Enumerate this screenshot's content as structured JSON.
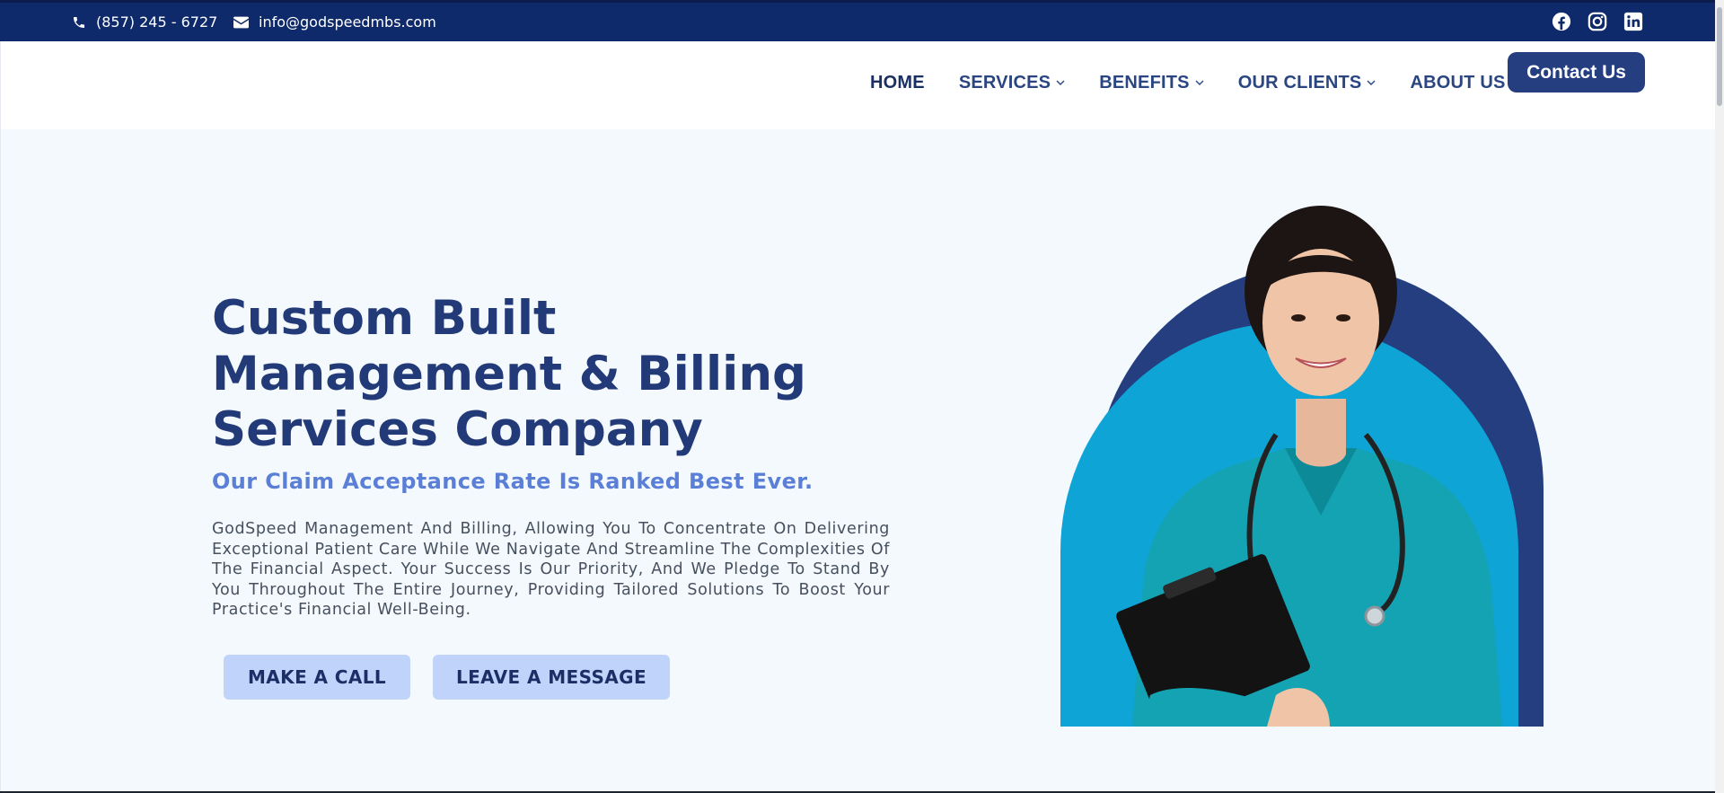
{
  "topbar": {
    "phone": "(857) 245 - 6727",
    "email": "info@godspeedmbs.com",
    "socials": [
      "facebook-icon",
      "instagram-icon",
      "linkedin-icon"
    ],
    "background": "#0f2a6b"
  },
  "nav": {
    "items": [
      {
        "label": "HOME",
        "dropdown": false
      },
      {
        "label": "SERVICES",
        "dropdown": true
      },
      {
        "label": "BENEFITS",
        "dropdown": true
      },
      {
        "label": "OUR CLIENTS",
        "dropdown": true
      },
      {
        "label": "ABOUT US",
        "dropdown": false
      }
    ],
    "contact_label": "Contact Us"
  },
  "hero": {
    "headline_lines": [
      "Custom Built",
      "Management & Billing",
      "Services Company"
    ],
    "subhead": "Our Claim Acceptance Rate Is Ranked Best Ever.",
    "paragraph": "GodSpeed Management And Billing, Allowing You To Concentrate On Delivering Exceptional Patient Care While We Navigate And Streamline The Complexities Of The Financial Aspect. Your Success Is Our Priority, And We Pledge To Stand By You Throughout The Entire Journey, Providing Tailored Solutions To Boost Your Practice's Financial Well-Being.",
    "call_label": "MAKE A CALL",
    "message_label": "LEAVE A MESSAGE"
  },
  "colors": {
    "brand_dark": "#243e7f",
    "accent_blue": "#5b7fd6",
    "button_light": "#c0d3fb",
    "hero_bg": "#f3f9fc"
  }
}
